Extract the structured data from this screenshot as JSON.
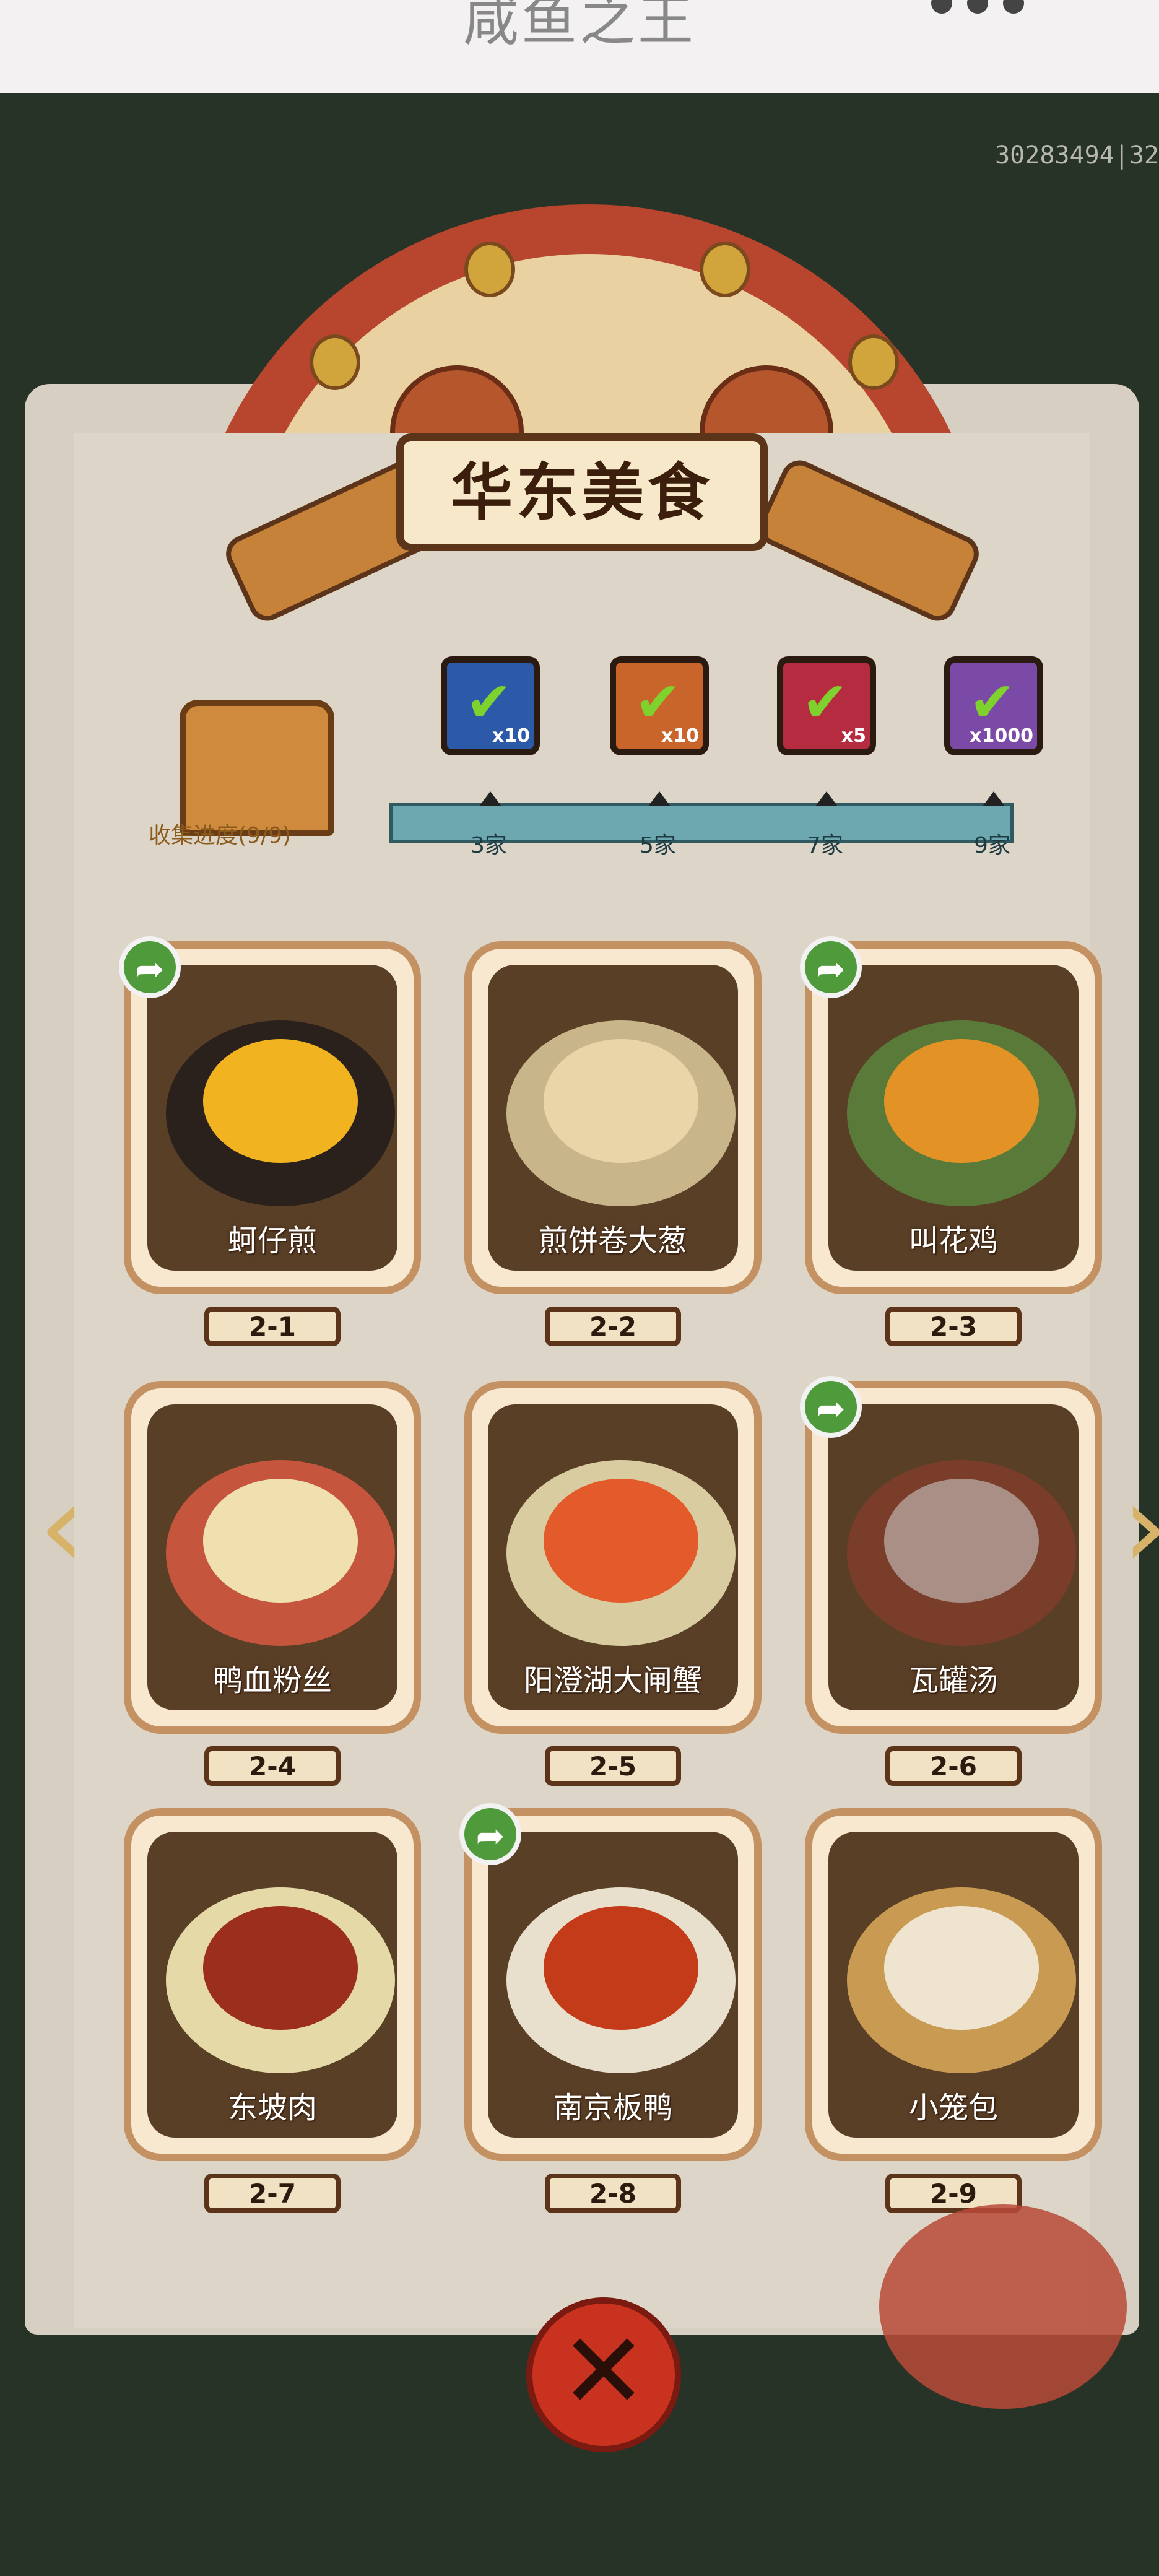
{
  "status_bar": {
    "title": "咸鱼之王"
  },
  "account_id": "30283494|32",
  "panel": {
    "title": "华东美食"
  },
  "progress": {
    "label": "收集进度(9/9)",
    "rewards": [
      {
        "icon": "gem-chest-icon",
        "count": "x10",
        "bg": "#2d5aa8",
        "milestone": "3家"
      },
      {
        "icon": "key-icon",
        "count": "x10",
        "bg": "#c9652a",
        "milestone": "5家"
      },
      {
        "icon": "orb-icon",
        "count": "x5",
        "bg": "#b52b3f",
        "milestone": "7家"
      },
      {
        "icon": "silver-bar-icon",
        "count": "x1000",
        "bg": "#7b4aa6",
        "milestone": "9家"
      }
    ]
  },
  "dishes": [
    {
      "name": "蚵仔煎",
      "level": "2-1",
      "shareable": true,
      "plate": "#2b211c",
      "food": "#f1b31f"
    },
    {
      "name": "煎饼卷大葱",
      "level": "2-2",
      "shareable": false,
      "plate": "#c8b58a",
      "food": "#ead5a8"
    },
    {
      "name": "叫花鸡",
      "level": "2-3",
      "shareable": true,
      "plate": "#5a7a3a",
      "food": "#e39325"
    },
    {
      "name": "鸭血粉丝",
      "level": "2-4",
      "shareable": false,
      "plate": "#c5553d",
      "food": "#f0e0b0"
    },
    {
      "name": "阳澄湖大闸蟹",
      "level": "2-5",
      "shareable": false,
      "plate": "#d9cca1",
      "food": "#e35b2a"
    },
    {
      "name": "瓦罐汤",
      "level": "2-6",
      "shareable": true,
      "plate": "#7a3d2a",
      "food": "#a98f86"
    },
    {
      "name": "东坡肉",
      "level": "2-7",
      "shareable": false,
      "plate": "#e5d9a8",
      "food": "#9c2e1d"
    },
    {
      "name": "南京板鸭",
      "level": "2-8",
      "shareable": true,
      "plate": "#e8e0cc",
      "food": "#c43b1a"
    },
    {
      "name": "小笼包",
      "level": "2-9",
      "shareable": false,
      "plate": "#c89a52",
      "food": "#efe4cf"
    }
  ],
  "nav": {
    "prev": "‹",
    "next": "›"
  },
  "close_button": {
    "label": "✕"
  }
}
